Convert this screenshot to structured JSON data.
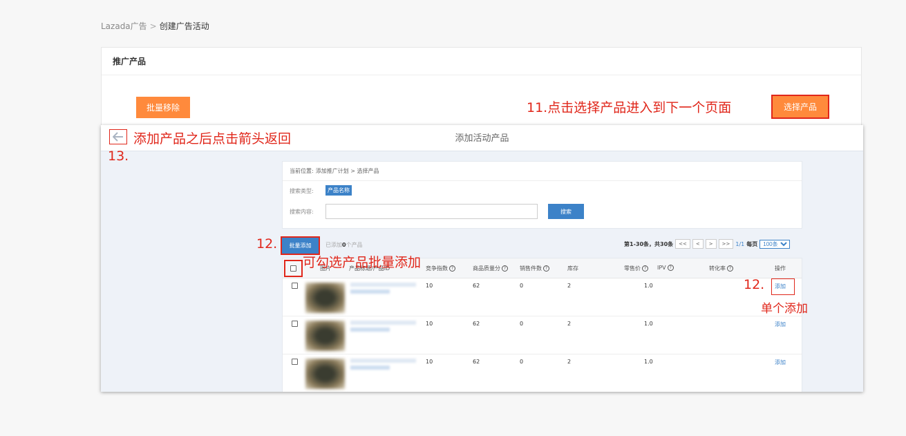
{
  "breadcrumb": {
    "root": "Lazada广告",
    "sep": ">",
    "current": "创建广告活动"
  },
  "card": {
    "title": "推广产品",
    "batch_remove": "批量移除",
    "select_products": "选择产品"
  },
  "annotations": {
    "a11": "11.点击选择产品进入到下一个页面",
    "a13_text": "添加产品之后点击箭头返回",
    "a13_num": "13.",
    "a12_num": "12.",
    "a12_batch": "可勾选产品批量添加",
    "a12_num_single": "12.",
    "a12_single": "单个添加"
  },
  "overlay": {
    "title": "添加活动产品",
    "location_label": "当前位置:",
    "location_path": "添加推广计划 > 选择产品",
    "search_type_label": "搜索类型:",
    "search_type_value": "产品名称",
    "search_content_label": "搜索内容:",
    "search_value": "",
    "search_button": "搜索",
    "batch_add": "批量添加",
    "added_prefix": "已添加",
    "added_count": "0",
    "added_suffix": "个产品",
    "pager": {
      "range": "第1-30条，共30条",
      "first": "<<",
      "prev": "<",
      "next": ">",
      "last": ">>",
      "page": "1/1",
      "per_page_label": "每页",
      "per_page_value": "100条"
    }
  },
  "table": {
    "headers": {
      "image": "图片",
      "title": "产品标题/产品ID",
      "competition": "竞争指数",
      "quality": "商品质量分",
      "sales": "销售件数",
      "stock": "库存",
      "retail": "零售价",
      "ipv": "IPV",
      "conversion": "转化率",
      "action": "操作"
    },
    "rows": [
      {
        "competition": "10",
        "quality": "62",
        "sales": "0",
        "stock": "2",
        "retail": "1.0",
        "action": "添加"
      },
      {
        "competition": "10",
        "quality": "62",
        "sales": "0",
        "stock": "2",
        "retail": "1.0",
        "action": "添加"
      },
      {
        "competition": "10",
        "quality": "62",
        "sales": "0",
        "stock": "2",
        "retail": "1.0",
        "action": "添加"
      }
    ]
  },
  "colors": {
    "orange": "#ff8a3c",
    "blue": "#3c82c8",
    "annotation_red": "#e0261a"
  },
  "icons": {
    "back": "arrow-left-icon",
    "help": "question-circle-icon"
  }
}
